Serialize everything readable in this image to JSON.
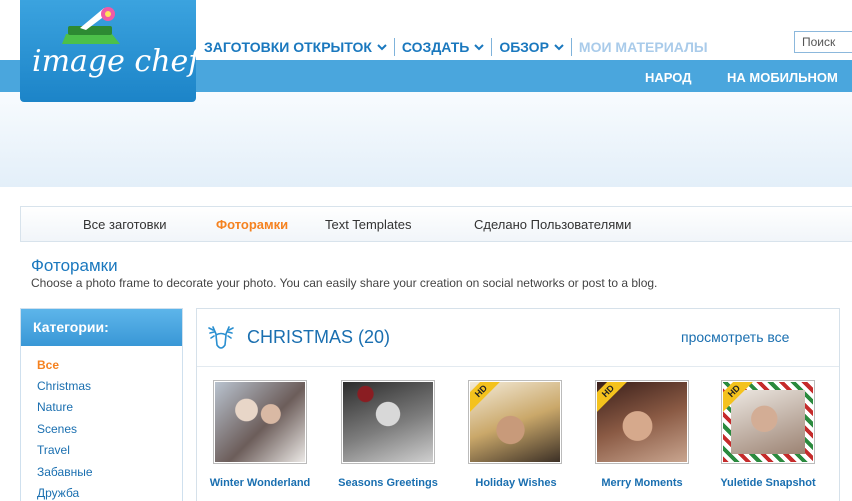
{
  "logo": {
    "text": "image chef"
  },
  "nav": {
    "items": [
      {
        "label": "ЗАГОТОВКИ ОТКРЫТОК"
      },
      {
        "label": "СОЗДАТЬ"
      },
      {
        "label": "ОБЗОР"
      },
      {
        "label": "МОИ МАТЕРИАЛЫ"
      }
    ],
    "search_placeholder": "Поиск",
    "sub": [
      "НАРОД",
      "НА МОБИЛЬНОМ"
    ]
  },
  "tabs": [
    {
      "label": "Все заготовки"
    },
    {
      "label": "Фоторамки",
      "active": true
    },
    {
      "label": "Text Templates"
    },
    {
      "label": "Сделано Пользователями"
    }
  ],
  "page": {
    "title": "Фоторамки",
    "description": "Choose a photo frame to decorate your photo. You can easily share your creation on social networks or post to a blog."
  },
  "sidebar": {
    "title": "Категории:",
    "items": [
      "Все",
      "Christmas",
      "Nature",
      "Scenes",
      "Travel",
      "Забавные",
      "Дружба"
    ]
  },
  "section": {
    "icon": "deer-icon",
    "title": "CHRISTMAS (20)",
    "view_all": "просмотреть все"
  },
  "templates": [
    {
      "label": "Winter Wonderland",
      "hd": false
    },
    {
      "label": "Seasons Greetings",
      "hd": false
    },
    {
      "label": "Holiday Wishes",
      "hd": true,
      "badge": "HD"
    },
    {
      "label": "Merry Moments",
      "hd": true,
      "badge": "HD"
    },
    {
      "label": "Yuletide Snapshot",
      "hd": true,
      "badge": "HD"
    }
  ],
  "colors": {
    "accent": "#1a78be",
    "active": "#f58220",
    "header_blue": "#4aa6dd"
  }
}
